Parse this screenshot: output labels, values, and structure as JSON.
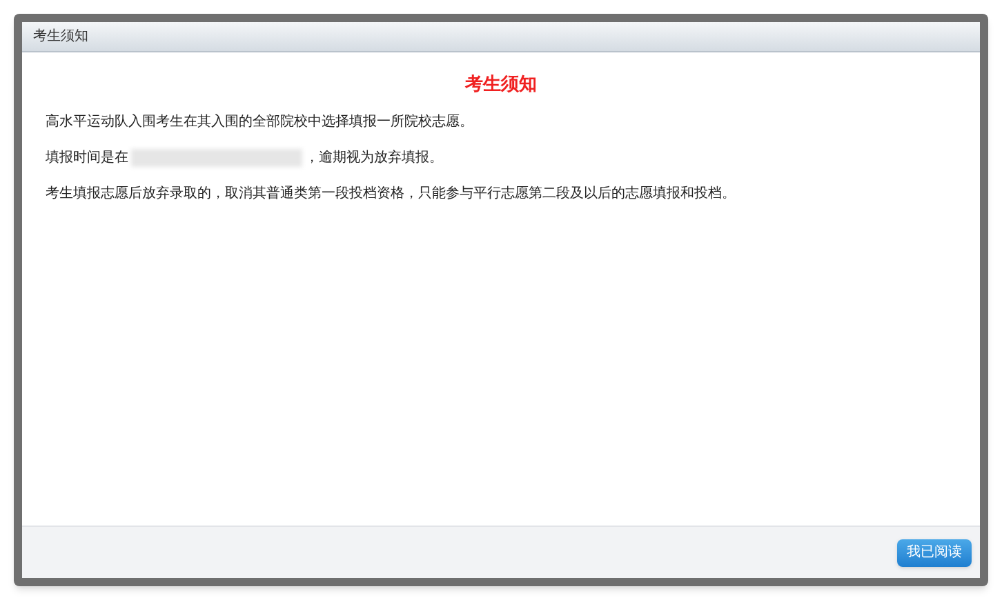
{
  "window": {
    "title": "考生须知"
  },
  "notice": {
    "heading": "考生须知",
    "paragraphs": [
      {
        "kind": "text",
        "text": "高水平运动队入围考生在其入围的全部院校中选择填报一所院校志愿。"
      },
      {
        "kind": "redacted",
        "before": "填报时间是在",
        "after": "，逾期视为放弃填报。"
      },
      {
        "kind": "text",
        "text": "考生填报志愿后放弃录取的，取消其普通类第一段投档资格，只能参与平行志愿第二段及以后的志愿填报和投档。"
      }
    ]
  },
  "buttons": [
    {
      "label": "我已阅读"
    }
  ]
}
